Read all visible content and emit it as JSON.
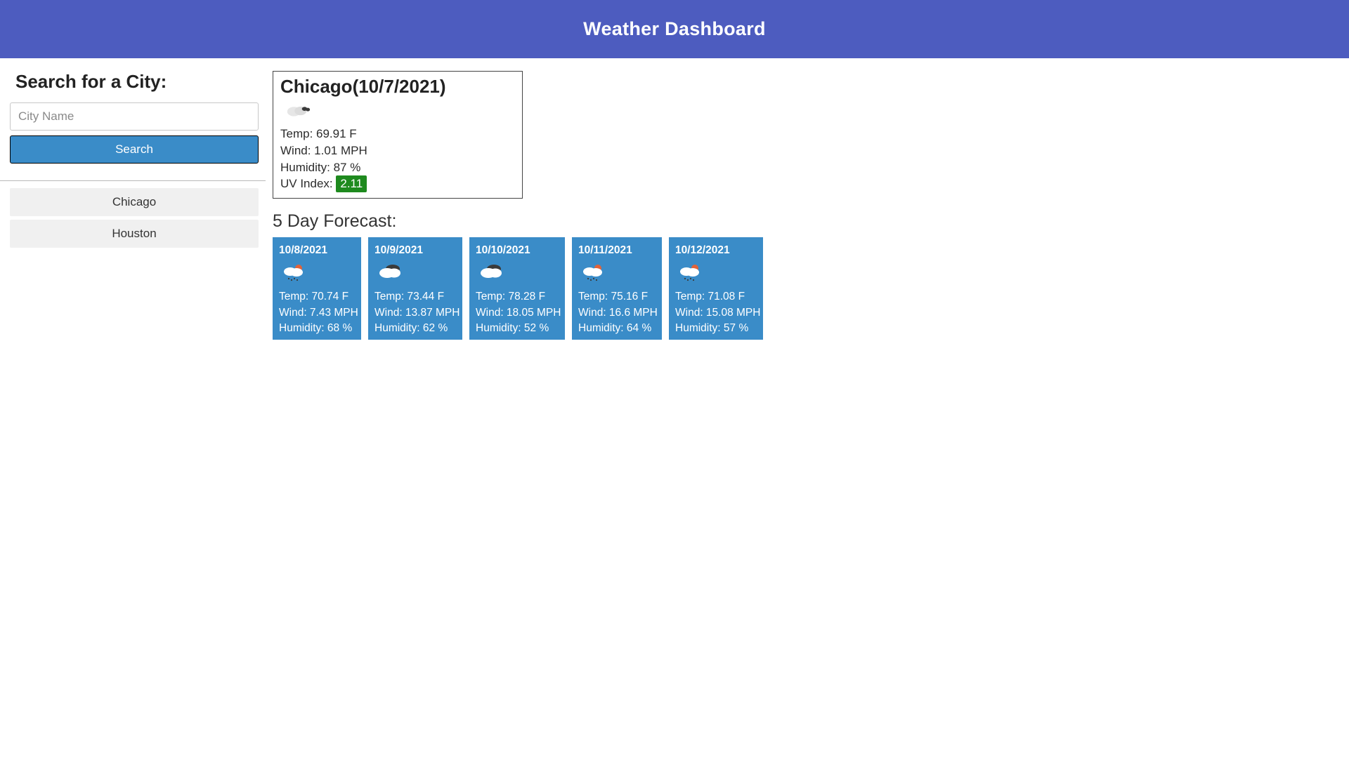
{
  "header": {
    "title": "Weather Dashboard"
  },
  "sidebar": {
    "search_heading": "Search for a City:",
    "input_placeholder": "City Name",
    "search_button": "Search",
    "history": [
      "Chicago",
      "Houston"
    ]
  },
  "current": {
    "title": "Chicago(10/7/2021)",
    "icon": "overcast",
    "temp_label": "Temp: 69.91 F",
    "wind_label": "Wind: 1.01 MPH",
    "humidity_label": "Humidity: 87 %",
    "uv_prefix": "UV Index: ",
    "uv_value": "2.11",
    "uv_color": "#1e8a1e"
  },
  "forecast": {
    "heading": "5 Day Forecast:",
    "days": [
      {
        "date": "10/8/2021",
        "icon": "sun-rain",
        "temp": "Temp: 70.74 F",
        "wind": "Wind: 7.43 MPH",
        "humidity": "Humidity: 68 %"
      },
      {
        "date": "10/9/2021",
        "icon": "cloudy-dark",
        "temp": "Temp: 73.44 F",
        "wind": "Wind: 13.87 MPH",
        "humidity": "Humidity: 62 %"
      },
      {
        "date": "10/10/2021",
        "icon": "cloudy-dark",
        "temp": "Temp: 78.28 F",
        "wind": "Wind: 18.05 MPH",
        "humidity": "Humidity: 52 %"
      },
      {
        "date": "10/11/2021",
        "icon": "sun-rain",
        "temp": "Temp: 75.16 F",
        "wind": "Wind: 16.6 MPH",
        "humidity": "Humidity: 64 %"
      },
      {
        "date": "10/12/2021",
        "icon": "sun-rain",
        "temp": "Temp: 71.08 F",
        "wind": "Wind: 15.08 MPH",
        "humidity": "Humidity: 57 %"
      }
    ]
  }
}
